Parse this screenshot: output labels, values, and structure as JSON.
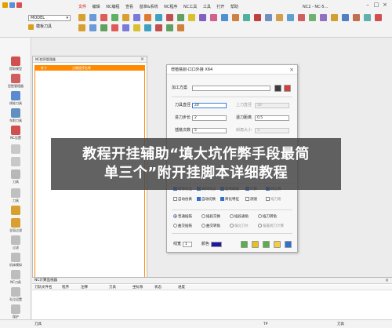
{
  "toolbar": {
    "model_select": "MODEL",
    "sub_label": "模板刀具",
    "menu": [
      "文件",
      "编辑",
      "NC编程",
      "查看",
      "基准&系统",
      "NC程序",
      "NC工具",
      "工具",
      "打开",
      "帮助"
    ],
    "nc_label": "NC2 - NC-5...",
    "window_controls": [
      "–",
      "□",
      "×"
    ]
  },
  "sidebar": {
    "items": [
      "提取模型",
      "型腔管理器",
      "线轮刀具",
      "车削刀具",
      "NC设置",
      "",
      "",
      "刀具",
      "刀具",
      "",
      "全局过滤",
      "过滤",
      "机床模拟",
      "NC刀具",
      "孔位设置",
      "保护"
    ]
  },
  "nc_panel": {
    "title": "NC程序管理器",
    "columns": [
      "补丁",
      "刀路程序名称"
    ]
  },
  "dialog": {
    "title": "增植铣削-口口外接 X64",
    "process_label": "加工方案",
    "tool_diameter_label": "刀具直径",
    "tool_diameter_value": "20",
    "upper_tool_diameter_label": "上刀直径",
    "upper_tool_diameter_value": "50",
    "feed_step_label": "进刀步长",
    "feed_step_value": "2",
    "retract_distance_label": "退刀距离",
    "retract_distance_value": "0.5",
    "segments_label": "插铣次数",
    "segments_value": "5",
    "taper_label": "斜角大小",
    "taper_value": "3",
    "checkbox_row1": [
      "精修周边",
      "满四周加",
      "套用模板",
      "计算",
      "刷分算"
    ],
    "checkbox_row2": [
      "自动仿真",
      "自动切换",
      "简化特征",
      "测速",
      "缩刀路"
    ],
    "radio_row1": [
      "普通插铣",
      "插段交换",
      "插段通角",
      "插刀转角"
    ],
    "radio_row2": [
      "曲交插铣",
      "曲交转角",
      "偏化刀补",
      "偏置刷刀计算"
    ],
    "line_label": "线宽",
    "line_value": "1",
    "color_label": "颜色"
  },
  "banner": {
    "line1": "教程开挂辅助“填大坑作弊手段最简",
    "line2": "单三个”附开挂脚本详细教程"
  },
  "bottom_panel": {
    "title": "NC计算监视器",
    "columns": [
      "刀轨文件名",
      "程序",
      "注释",
      "刀具",
      "坐标系",
      "状态",
      "进度"
    ],
    "status_fields": [
      "刀具",
      "TP",
      "刀具"
    ]
  }
}
